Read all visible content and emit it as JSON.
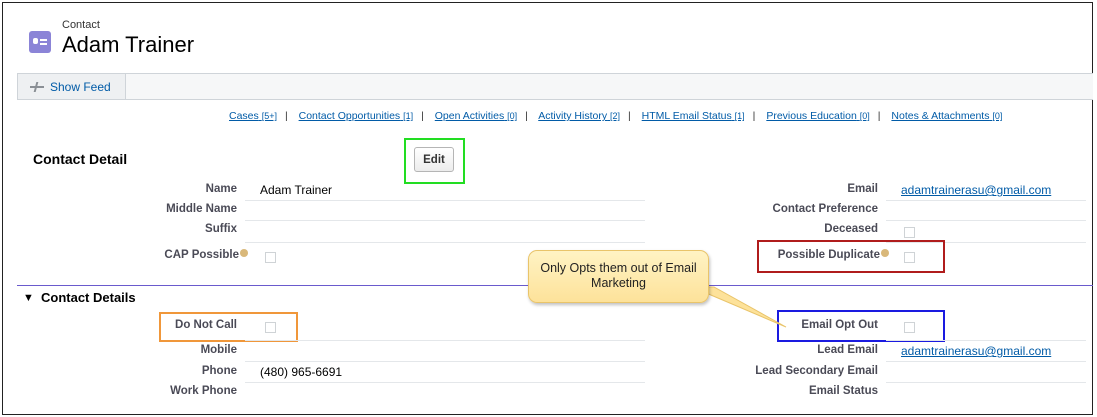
{
  "header": {
    "object_type": "Contact",
    "record_name": "Adam Trainer"
  },
  "feed": {
    "show_feed_label": "Show Feed"
  },
  "related_links": [
    {
      "label": "Cases",
      "count": "[5+]"
    },
    {
      "label": "Contact Opportunities",
      "count": "[1]"
    },
    {
      "label": "Open Activities",
      "count": "[0]"
    },
    {
      "label": "Activity History",
      "count": "[2]"
    },
    {
      "label": "HTML Email Status",
      "count": "[1]"
    },
    {
      "label": "Previous Education",
      "count": "[0]"
    },
    {
      "label": "Notes & Attachments",
      "count": "[0]"
    }
  ],
  "detail": {
    "title": "Contact Detail",
    "edit_label": "Edit",
    "left": [
      {
        "label": "Name",
        "value": "Adam Trainer"
      },
      {
        "label": "Middle Name",
        "value": ""
      },
      {
        "label": "Suffix",
        "value": ""
      },
      {
        "label": "CAP Possible",
        "value": ""
      }
    ],
    "right": [
      {
        "label": "Email",
        "value": "adamtrainerasu@gmail.com"
      },
      {
        "label": "Contact Preference",
        "value": ""
      },
      {
        "label": "Deceased",
        "value": ""
      },
      {
        "label": "Possible Duplicate",
        "value": ""
      }
    ]
  },
  "details_section": {
    "title": "Contact Details",
    "left": [
      {
        "label": "Do Not Call",
        "value": ""
      },
      {
        "label": "Mobile",
        "value": ""
      },
      {
        "label": "Phone",
        "value": "(480) 965-6691"
      },
      {
        "label": "Work Phone",
        "value": ""
      }
    ],
    "right": [
      {
        "label": "Email Opt Out",
        "value": ""
      },
      {
        "label": "Lead Email",
        "value": "adamtrainerasu@gmail.com"
      },
      {
        "label": "Lead Secondary Email",
        "value": ""
      },
      {
        "label": "Email Status",
        "value": ""
      }
    ]
  },
  "callout": {
    "text": "Only Opts them out of Email Marketing"
  },
  "highlight_colors": {
    "edit": "#22dd22",
    "possible_duplicate": "#b01c1c",
    "do_not_call": "#f0973a",
    "email_opt_out": "#1a1ae0"
  }
}
